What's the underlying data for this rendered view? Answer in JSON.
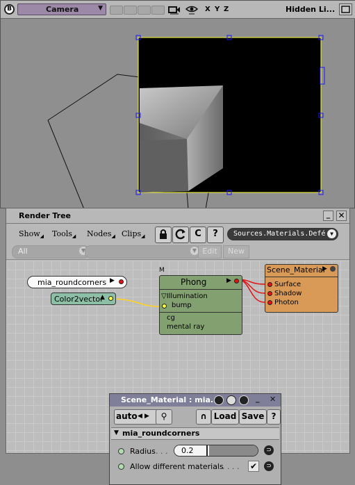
{
  "viewport": {
    "camera_label": "Camera",
    "axes": [
      "X",
      "Y",
      "Z"
    ],
    "display_mode": "Hidden Li..."
  },
  "render_tree": {
    "title": "Render Tree",
    "menus": [
      "Show",
      "Tools",
      "Nodes",
      "Clips"
    ],
    "source_path": "Sources.Materials.Defé",
    "filter_value": "All",
    "edit_label": "Edit",
    "new_label": "New",
    "nodes": {
      "roundcorners": "mia_roundcorners",
      "color2vector": "Color2vector",
      "phong": {
        "marker": "M",
        "title": "Phong",
        "group": "Illumination",
        "port_bump": "bump",
        "port_cg": "cg",
        "port_mental": "mental ray"
      },
      "scene_material": {
        "title": "Scene_Material",
        "ports": [
          "Surface",
          "Shadow",
          "Photon"
        ]
      }
    }
  },
  "property_editor": {
    "title": "Scene_Material : mia...",
    "auto_label": "auto",
    "load_label": "Load",
    "save_label": "Save",
    "section": "mia_roundcorners",
    "radius_label": "Radius",
    "radius_value": "0.2",
    "radius_fill": 0.4,
    "allow_label": "Allow different materials",
    "allow_checked": true
  },
  "colors": {
    "phong_node": "#82a070",
    "color2vector_node": "#8cbfa6",
    "scene_material_node": "#d99a58",
    "connection_red": "#e01414",
    "connection_yellow": "#ffd21e"
  }
}
